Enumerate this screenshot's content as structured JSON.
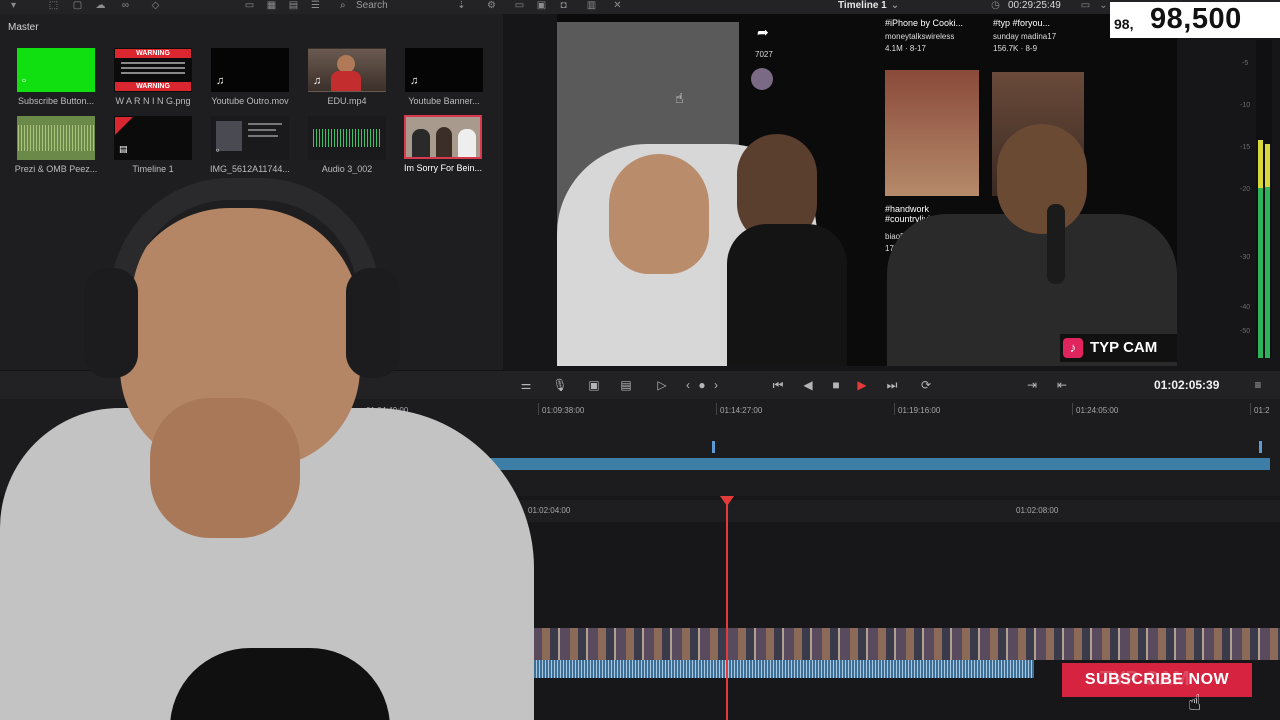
{
  "toolbar": {
    "search_placeholder": "Search",
    "timeline_name": "Timeline 1",
    "timecode_top": "00:29:25:49"
  },
  "media_pool": {
    "title": "Master",
    "clips": [
      {
        "name": "Subscribe Button...",
        "kind": "green"
      },
      {
        "name": "W A R N I N G.png",
        "kind": "warning",
        "text": "WARNING"
      },
      {
        "name": "Youtube Outro.mov",
        "kind": "black"
      },
      {
        "name": "EDU.mp4",
        "kind": "person"
      },
      {
        "name": "Youtube Banner...",
        "kind": "black"
      },
      {
        "name": "Prezi & OMB Peez...",
        "kind": "audio-green"
      },
      {
        "name": "Timeline 1",
        "kind": "timeline"
      },
      {
        "name": "IMG_5612A11744...",
        "kind": "screenshot"
      },
      {
        "name": "Audio 3_002",
        "kind": "audio"
      },
      {
        "name": "Im Sorry For Bein...",
        "kind": "selected"
      }
    ]
  },
  "viewer": {
    "tiktok_items": [
      {
        "caption": "#iPhone by Cooki...",
        "user": "moneytalkswireless",
        "stats": "4.1M · 8-17"
      },
      {
        "caption": "#typ #foryou...",
        "user": "sunday madina17",
        "stats": "156.7K · 8-9"
      },
      {
        "caption": "#handwork #countryliving...",
        "user": "biao508",
        "stats": "175.1K"
      }
    ],
    "like_count": "7027",
    "typcam_label": "TYP CAM",
    "meter_scale": [
      "-5",
      "-10",
      "-15",
      "-20",
      "-30",
      "-40",
      "-50"
    ]
  },
  "subscriber_counter": {
    "small": "98,",
    "big": "98,500"
  },
  "transport": {
    "timecode": "01:02:05:39"
  },
  "upper_ruler": [
    "01:04:49:00",
    "01:09:38:00",
    "01:14:27:00",
    "01:19:16:00",
    "01:24:05:00",
    "01:2"
  ],
  "lower_ruler": [
    "01:02:04:00",
    "01:02:08:00"
  ],
  "subscribe_button": {
    "label": "SUBSCRIBE NOW",
    "watermark": "TYP CAM"
  },
  "colors": {
    "accent": "#e43a3a",
    "track": "#3d7ea6",
    "green": "#2fb35a"
  }
}
